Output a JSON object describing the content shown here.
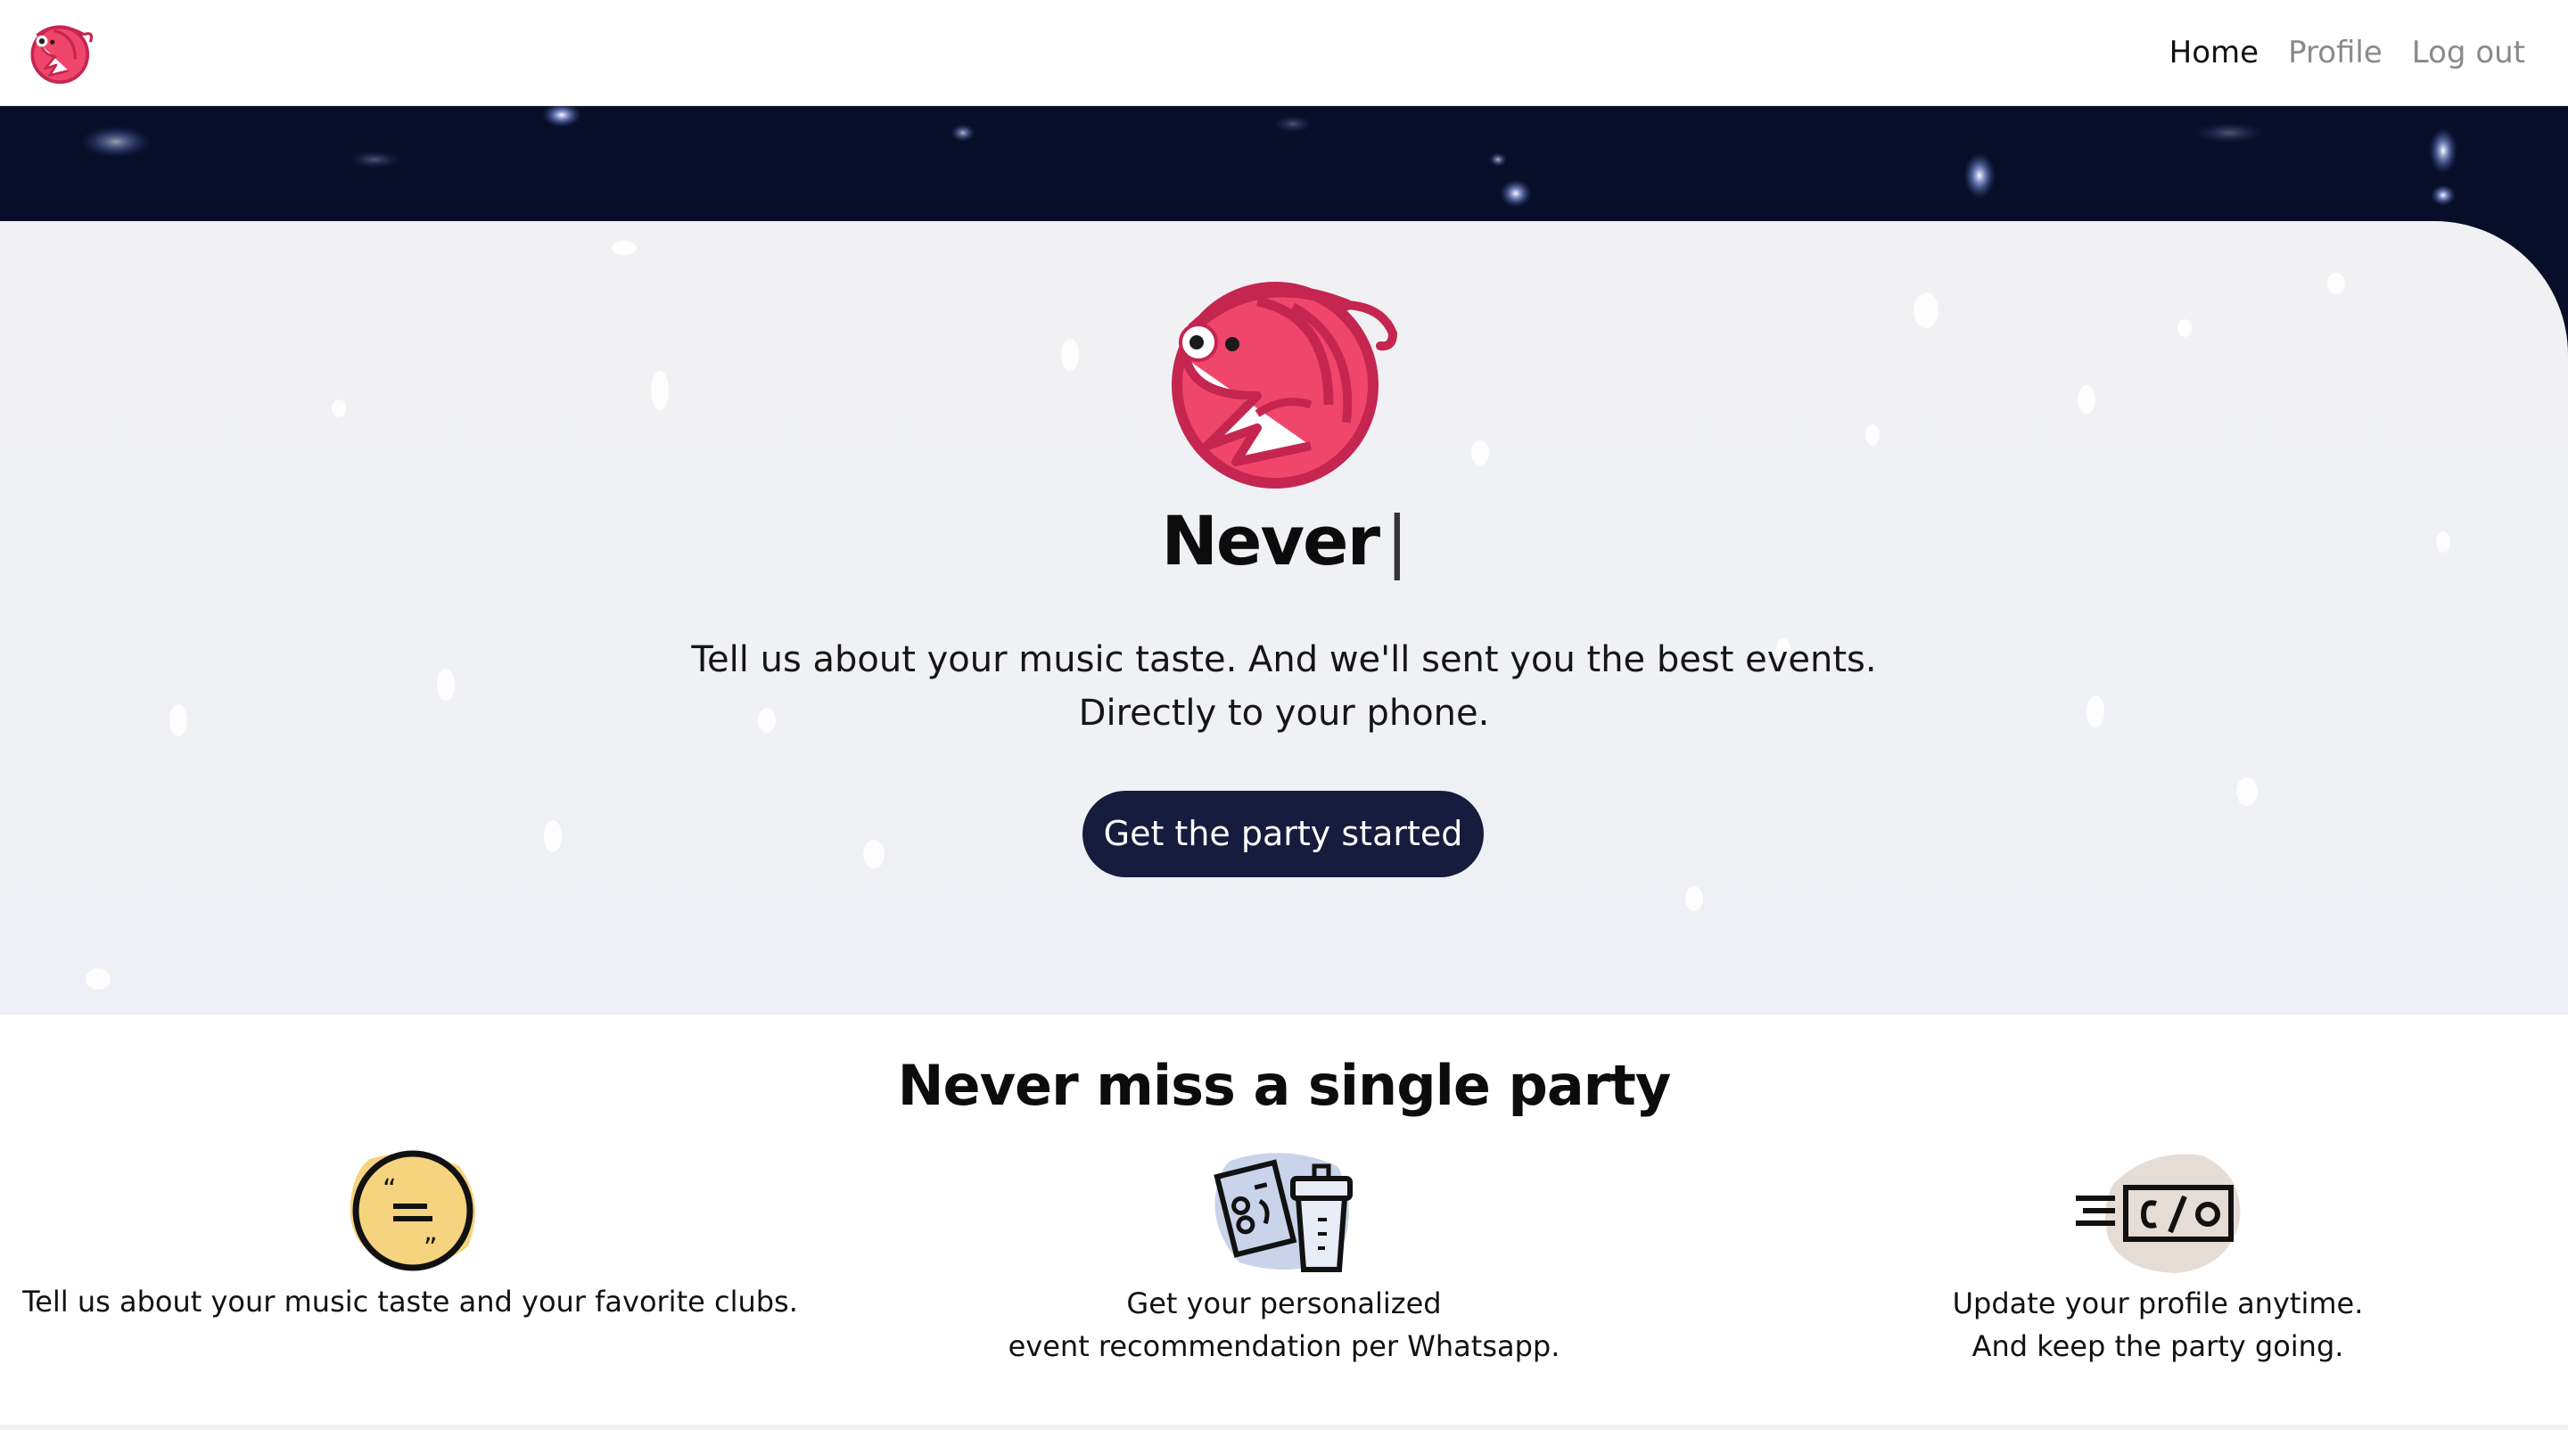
{
  "navbar": {
    "logo_icon": "shrimp-logo-icon",
    "links": [
      {
        "label": "Home",
        "active": true
      },
      {
        "label": "Profile",
        "active": false
      },
      {
        "label": "Log out",
        "active": false
      }
    ]
  },
  "hero": {
    "title": "Never",
    "cursor": "|",
    "subtitle_line1": "Tell us about your music taste. And we'll sent you the best events.",
    "subtitle_line2": "Directly to your phone.",
    "cta_label": "Get the party started",
    "logo_icon": "shrimp-logo-icon"
  },
  "features": {
    "title": "Never miss a single party",
    "items": [
      {
        "icon": "quote-bubble-icon",
        "lines": [
          "Tell us about your music taste and your favorite clubs."
        ]
      },
      {
        "icon": "flyer-and-drink-icon",
        "lines": [
          "Get your personalized",
          "event recommendation per Whatsapp."
        ]
      },
      {
        "icon": "ticket-co-icon",
        "lines": [
          "Update your profile anytime.",
          "And keep the party going."
        ]
      }
    ]
  },
  "colors": {
    "brand_pink": "#e8395f",
    "brand_dark": "#b8254a",
    "cta_navy": "#151c3d",
    "hero_dark": "#070e28",
    "icon_yellow": "#f5d37f",
    "icon_blue": "#c9d3ea",
    "icon_beige": "#e5dcd6"
  }
}
